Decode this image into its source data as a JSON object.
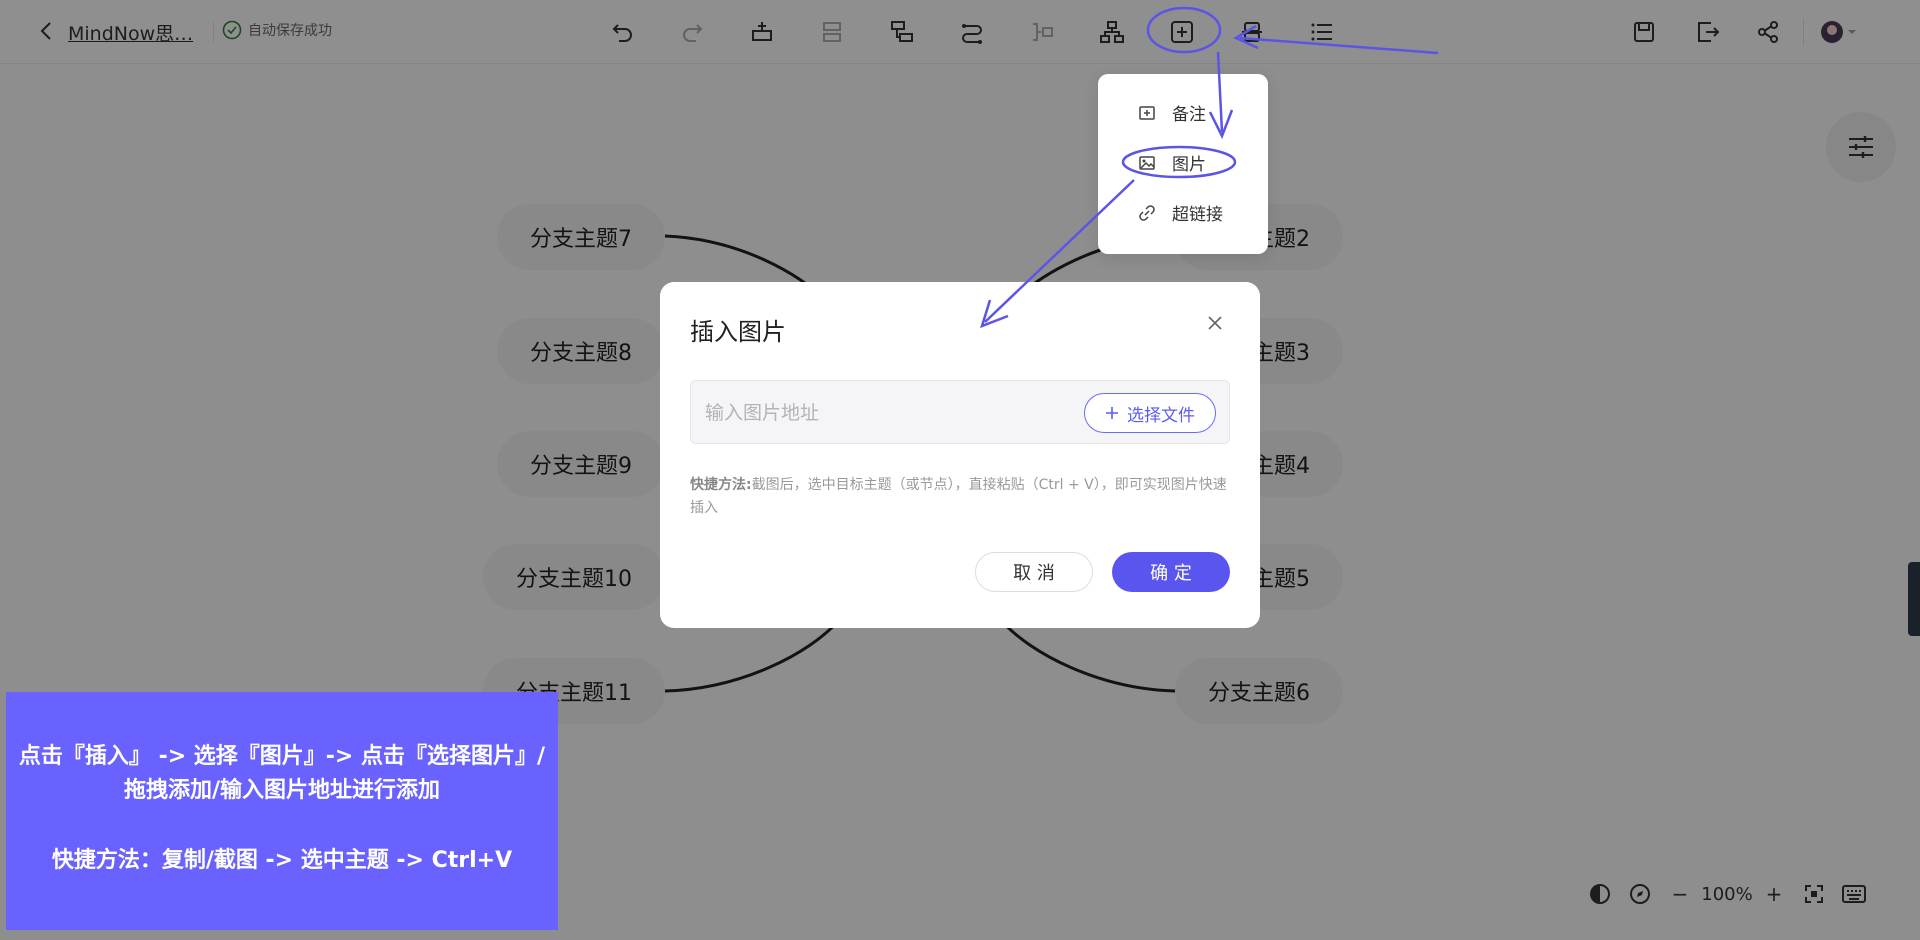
{
  "header": {
    "back_icon": "chevron-left-icon",
    "doc_title": "MindNow思…",
    "save_status": "自动保存成功",
    "toolbar_icons": [
      "undo-icon",
      "redo-icon",
      "insert-topic-icon",
      "insert-subtopic-icon",
      "insert-parent-icon",
      "relation-icon",
      "summary-icon",
      "structure-icon",
      "insert-icon",
      "style-icon",
      "outline-icon"
    ],
    "right_icons": [
      "save-icon",
      "export-icon",
      "share-icon",
      "avatar"
    ]
  },
  "dropdown": {
    "items": [
      {
        "label": "备注",
        "icon": "note-icon"
      },
      {
        "label": "图片",
        "icon": "image-icon"
      },
      {
        "label": "超链接",
        "icon": "link-icon"
      }
    ]
  },
  "canvas": {
    "left_nodes": [
      "分支主题7",
      "分支主题8",
      "分支主题9",
      "分支主题10",
      "分支主题11"
    ],
    "right_nodes": [
      "分支主题2",
      "分支主题3",
      "分支主题4",
      "分支主题5",
      "分支主题6"
    ]
  },
  "modal": {
    "title": "插入图片",
    "input_placeholder": "输入图片地址",
    "choose_file_label": "选择文件",
    "tip_label": "快捷方法:",
    "tip_text": "截图后，选中目标主题（或节点），直接粘贴（Ctrl + V），即可实现图片快速插入",
    "cancel_label": "取 消",
    "ok_label": "确 定"
  },
  "tutorial": {
    "line1": "点击『插入』 -> 选择『图片』-> 点击『选择图片』/拖拽添加/输入图片地址进行添加",
    "line2": "快捷方法：复制/截图 -> 选中主题 -> Ctrl+V"
  },
  "bottom_bar": {
    "zoom_level": "100%",
    "minus": "−",
    "plus": "+"
  },
  "colors": {
    "accent": "#5b55f0",
    "annotation": "#5a55e6",
    "tutorial_bg": "#6a62ff"
  }
}
